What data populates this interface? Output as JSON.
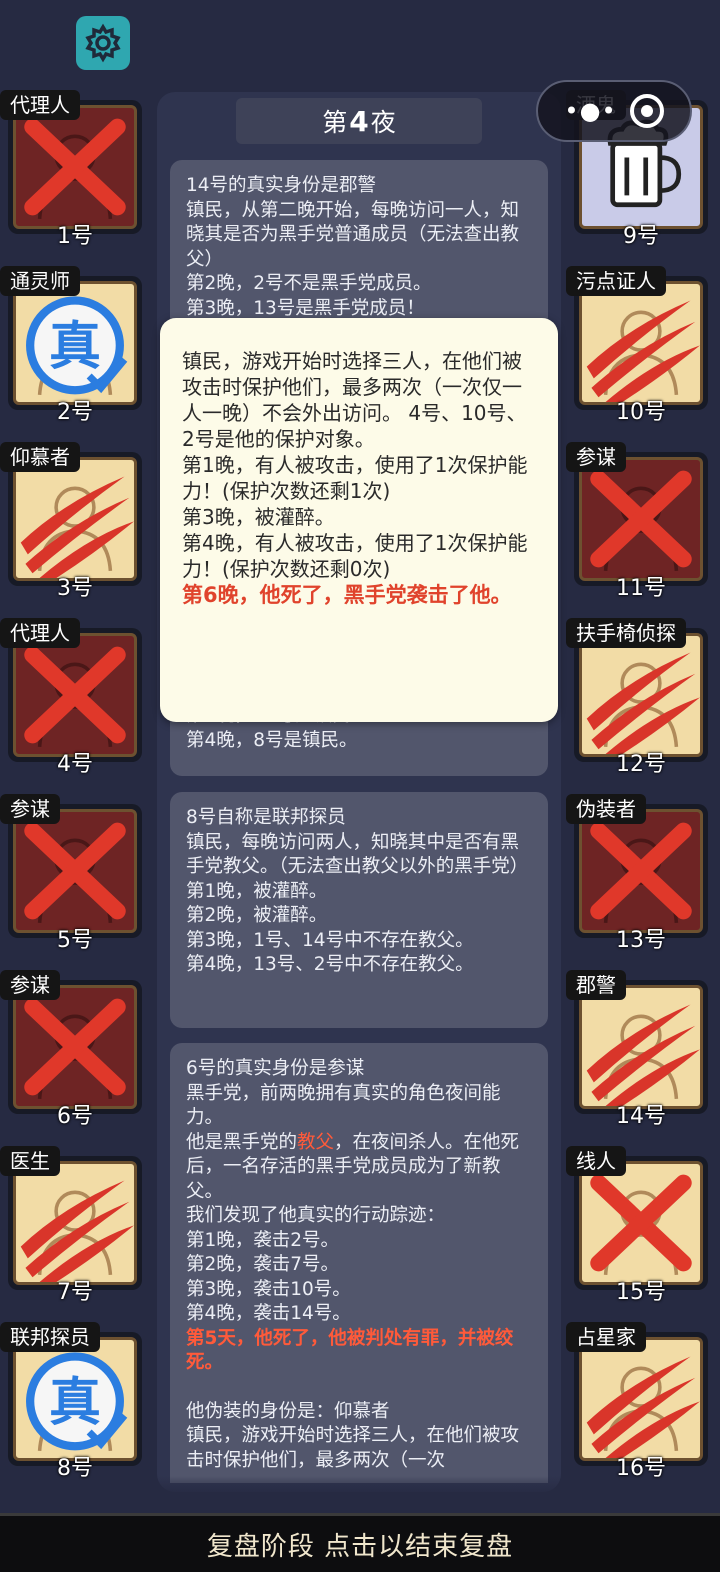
{
  "header": {
    "night_prefix": "第",
    "night_number": "4",
    "night_suffix": "夜"
  },
  "left_players": [
    {
      "role": "代理人",
      "num": "1号",
      "face": "dark",
      "mark": "x"
    },
    {
      "role": "通灵师",
      "num": "2号",
      "face": "light",
      "mark": "true"
    },
    {
      "role": "仰慕者",
      "num": "3号",
      "face": "light",
      "mark": "claw"
    },
    {
      "role": "代理人",
      "num": "4号",
      "face": "dark",
      "mark": "x"
    },
    {
      "role": "参谋",
      "num": "5号",
      "face": "dark",
      "mark": "x"
    },
    {
      "role": "参谋",
      "num": "6号",
      "face": "dark",
      "mark": "x"
    },
    {
      "role": "医生",
      "num": "7号",
      "face": "light",
      "mark": "claw"
    },
    {
      "role": "联邦探员",
      "num": "8号",
      "face": "light",
      "mark": "true"
    }
  ],
  "right_players": [
    {
      "role": "酒鬼",
      "num": "9号",
      "face": "blue",
      "mark": "none"
    },
    {
      "role": "污点证人",
      "num": "10号",
      "face": "light",
      "mark": "claw"
    },
    {
      "role": "参谋",
      "num": "11号",
      "face": "dark",
      "mark": "x"
    },
    {
      "role": "扶手椅侦探",
      "num": "12号",
      "face": "light",
      "mark": "claw"
    },
    {
      "role": "伪装者",
      "num": "13号",
      "face": "dark",
      "mark": "x"
    },
    {
      "role": "郡警",
      "num": "14号",
      "face": "light",
      "mark": "claw"
    },
    {
      "role": "线人",
      "num": "15号",
      "face": "light",
      "mark": "x"
    },
    {
      "role": "占星家",
      "num": "16号",
      "face": "light",
      "mark": "claw"
    }
  ],
  "true_badge": "真",
  "card1": {
    "text": "14号的真实身份是郡警\n镇民，从第二晚开始，每晚访问一人，知晓其是否为黑手党普通成员（无法查出教父）\n第2晚，2号不是黑手党成员。\n第3晚，13号是黑手党成员！"
  },
  "card1_tail": {
    "text": "第3晚，12号是镇民。\n第4晚，8号是镇民。"
  },
  "card2": {
    "text": "8号自称是联邦探员\n镇民，每晚访问两人，知晓其中是否有黑手党教父。（无法查出教父以外的黑手党）\n第1晚，被灌醉。\n第2晚，被灌醉。\n第3晚，1号、14号中不存在教父。\n第4晚，13号、2号中不存在教父。"
  },
  "card3": {
    "line1": "6号的真实身份是参谋",
    "line2": "黑手党，前两晚拥有真实的角色夜间能力。",
    "line3a": "他是黑手党的",
    "line3b": "教父",
    "line3c": "，在夜间杀人。在他死后，一名存活的黑手党成员成为了新教父。",
    "line4": "我们发现了他真实的行动踪迹：\n第1晚，袭击2号。\n第2晚，袭击7号。\n第3晚，袭击10号。\n第4晚，袭击14号。",
    "death": "第5天，他死了，他被判处有罪，并被绞死。",
    "line5": "他伪装的身份是：仰慕者\n镇民，游戏开始时选择三人，在他们被攻击时保护他们，最多两次（一次"
  },
  "popup": {
    "text": "镇民，游戏开始时选择三人，在他们被攻击时保护他们，最多两次（一次仅一人一晚）不会外出访问。 4号、10号、2号是他的保护对象。\n第1晚，有人被攻击，使用了1次保护能力！(保护次数还剩1次)\n第3晚，被灌醉。\n第4晚，有人被攻击，使用了1次保护能力！(保护次数还剩0次)",
    "death": "第6晚，他死了，黑手党袭击了他。"
  },
  "footer": {
    "label": "复盘阶段 点击以结束复盘"
  },
  "colors": {
    "background": "#262a42",
    "card": "#52566c",
    "popup": "#fdfbe8",
    "death_red": "#e0432c",
    "dead_face": "#6e2424",
    "alive_face": "#f2dca6",
    "gear": "#2fa7b0"
  },
  "icons": [
    "gear-icon",
    "more-dots-icon",
    "close-circle-icon",
    "x-mark-icon",
    "claw-scratch-icon",
    "true-badge-icon",
    "beer-mug-icon"
  ]
}
